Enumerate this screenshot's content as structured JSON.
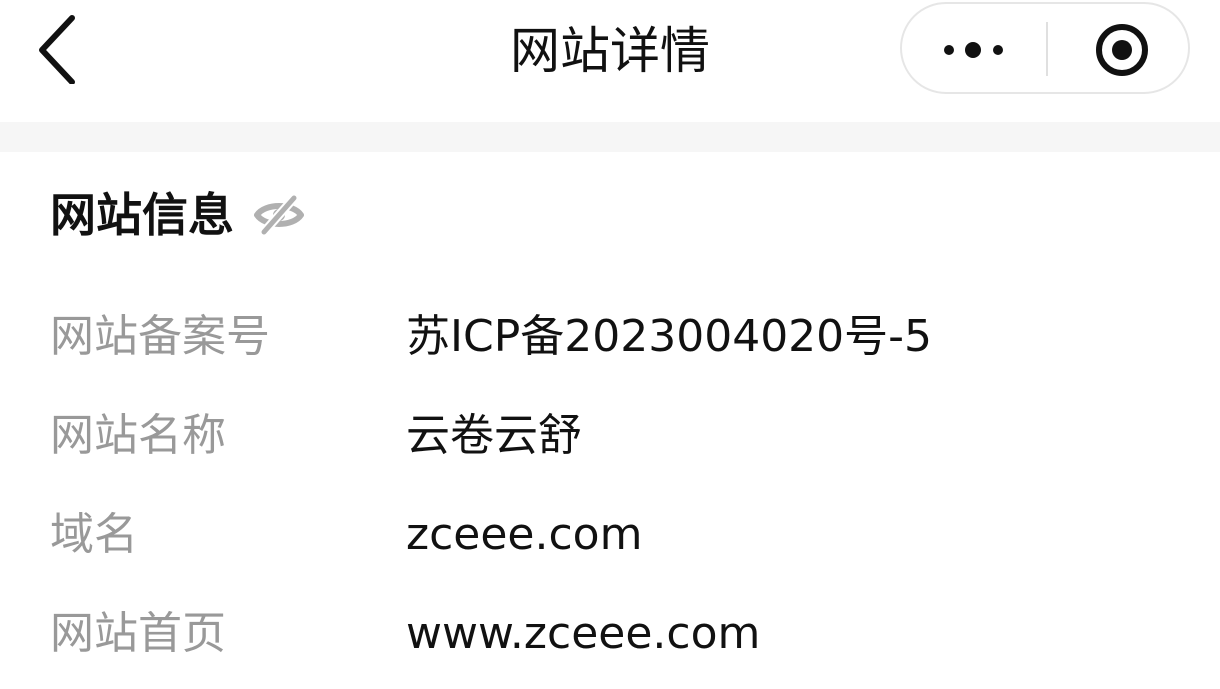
{
  "navbar": {
    "title": "网站详情",
    "back_icon": "chevron-left-icon",
    "more_icon": "more-dots-icon",
    "close_icon": "target-circle-icon"
  },
  "section": {
    "title": "网站信息",
    "visibility_icon": "eye-off-icon"
  },
  "info_rows": [
    {
      "label": "网站备案号",
      "value": "苏ICP备2023004020号-5"
    },
    {
      "label": "网站名称",
      "value": "云卷云舒"
    },
    {
      "label": "域名",
      "value": "zceee.com"
    },
    {
      "label": "网站首页",
      "value": "www.zceee.com"
    }
  ],
  "colors": {
    "background": "#ffffff",
    "band": "#f6f6f6",
    "label": "#999999",
    "value": "#111111",
    "icon_gray": "#b0b0b0"
  }
}
